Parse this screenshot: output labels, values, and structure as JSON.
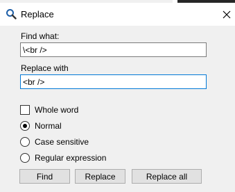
{
  "window": {
    "title": "Replace",
    "close_glyph": "×"
  },
  "find": {
    "label": "Find what:",
    "value": "\\<br />"
  },
  "replace": {
    "label": "Replace with",
    "value": "<br />"
  },
  "options": {
    "whole_word": {
      "label": "Whole word",
      "checked": false
    },
    "modes": [
      {
        "label": "Normal",
        "selected": true
      },
      {
        "label": "Case sensitive",
        "selected": false
      },
      {
        "label": "Regular expression",
        "selected": false
      }
    ]
  },
  "buttons": {
    "find": "Find",
    "replace": "Replace",
    "replace_all": "Replace all"
  },
  "icons": {
    "app": "search-replace-icon",
    "close": "close-icon"
  },
  "colors": {
    "focus_border": "#0078d7",
    "background": "#f0f0f0"
  }
}
